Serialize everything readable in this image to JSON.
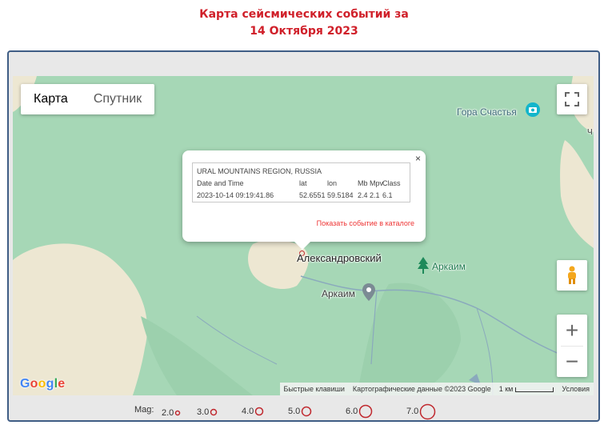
{
  "page": {
    "title_line1": "Карта сейсмических событий за",
    "title_line2": "14 Октября 2023"
  },
  "map": {
    "type_buttons": [
      "Карта",
      "Спутник"
    ],
    "active_type": "Карта",
    "places": {
      "gora": "Гора Счастья",
      "aleksandrovsky": "Александровский",
      "arkaim_park": "Аркаим",
      "arkaim_poi": "Аркаим",
      "edge": "Ч"
    },
    "icons": {
      "fullscreen": "fullscreen-icon",
      "pegman": "pegman-icon",
      "zoom_in": "+",
      "zoom_out": "−",
      "close": "×",
      "camera": "camera-icon",
      "tree": "tree-icon",
      "pin": "pin-icon"
    },
    "colors": {
      "forest": "#a6d7b6",
      "terrain": "#ede7d2",
      "river": "#8aa9bd",
      "epicenter": "#c0282e"
    },
    "google_logo": "Google",
    "attribution": {
      "shortcuts": "Быстрые клавиши",
      "data": "Картографические данные ©2023 Google",
      "scale": "1 км",
      "terms": "Условия"
    }
  },
  "event": {
    "region": "URAL MOUNTAINS REGION, RUSSIA",
    "headers": [
      "Date and Time",
      "lat",
      "lon",
      "Mb",
      "Mpv",
      "Class"
    ],
    "values": [
      "2023-10-14 09:19:41.86",
      "52.6551",
      "59.5184",
      "2.4",
      "2.1",
      "6.1"
    ],
    "link": "Показать событие в каталоге"
  },
  "legend": {
    "label": "Mag:",
    "items": [
      {
        "label": "2.0",
        "radius": 2.5
      },
      {
        "label": "3.0",
        "radius": 3.5
      },
      {
        "label": "4.0",
        "radius": 4.5
      },
      {
        "label": "5.0",
        "radius": 5.5
      },
      {
        "label": "6.0",
        "radius": 7.5
      },
      {
        "label": "7.0",
        "radius": 9
      }
    ]
  }
}
